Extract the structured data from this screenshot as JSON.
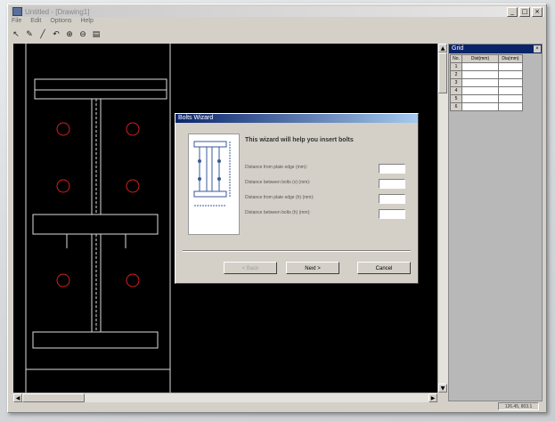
{
  "window": {
    "title": "Untitled - [Drawing1]",
    "menus": [
      "File",
      "Edit",
      "Options",
      "Help"
    ]
  },
  "toolbar": {
    "tools": [
      "pointer-icon",
      "pencil-icon",
      "line-icon",
      "undo-icon",
      "zoom-in-icon",
      "zoom-out-icon",
      "print-icon"
    ]
  },
  "side_panel": {
    "title": "Grid",
    "columns": [
      "No.",
      "Dist(mm)",
      "Dia(mm)"
    ],
    "rows": [
      [
        "1",
        "",
        ""
      ],
      [
        "2",
        "",
        ""
      ],
      [
        "3",
        "",
        ""
      ],
      [
        "4",
        "",
        ""
      ],
      [
        "5",
        "",
        ""
      ],
      [
        "6",
        "",
        ""
      ]
    ]
  },
  "dialog": {
    "title": "Bolts Wizard",
    "heading": "This wizard will help you insert bolts",
    "fields": [
      {
        "label": "Distance from plate edge (mm):",
        "value": ""
      },
      {
        "label": "Distance between bolts (v) (mm):",
        "value": ""
      },
      {
        "label": "Distance from plate edge (h) (mm):",
        "value": ""
      },
      {
        "label": "Distance between bolts (h) (mm):",
        "value": ""
      }
    ],
    "buttons": {
      "back": "< Back",
      "next": "Next >",
      "cancel": "Cancel"
    }
  },
  "status": {
    "coords": "126.45, 803.1"
  },
  "colors": {
    "canvas": "#000000",
    "lines": "#dcdcdc",
    "holes": "#d62020",
    "titlebar": "#0a246a"
  }
}
